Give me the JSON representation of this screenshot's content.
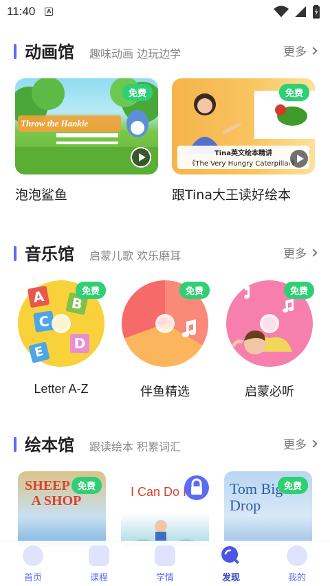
{
  "status": {
    "time": "11:40",
    "notif_letter": "A"
  },
  "sections": {
    "animation": {
      "title": "动画馆",
      "subtitle": "趣味动画 边玩边学",
      "more": "更多",
      "items": [
        {
          "title": "泡泡鲨鱼",
          "badge": "免费",
          "thumb_text": "Throw the Hankie"
        },
        {
          "title": "跟Tina大王读好绘本",
          "badge": "免费",
          "thumb_text": "Tina英文绘本精讲",
          "thumb_sub": "《The Very Hungry Caterpillar》"
        }
      ]
    },
    "music": {
      "title": "音乐馆",
      "subtitle": "启蒙儿歌 欢乐磨耳",
      "more": "更多",
      "items": [
        {
          "title": "Letter A-Z",
          "badge": "免费",
          "letters": [
            "A",
            "B",
            "C",
            "D",
            "E"
          ]
        },
        {
          "title": "伴鱼精选",
          "badge": "免费"
        },
        {
          "title": "启蒙必听",
          "badge": "免费"
        }
      ]
    },
    "books": {
      "title": "绘本馆",
      "subtitle": "跟读绘本 积累词汇",
      "more": "更多",
      "items": [
        {
          "cover_text": "SHEEP IN A SHOP",
          "badge": "免费",
          "locked": false
        },
        {
          "cover_text": "I Can Do It",
          "badge": "",
          "locked": true
        },
        {
          "cover_text": "Tom Big Drop",
          "badge": "免费",
          "locked": false
        }
      ]
    }
  },
  "bottom_nav": [
    {
      "label": "首页",
      "icon": "home-icon",
      "active": false
    },
    {
      "label": "课程",
      "icon": "course-icon",
      "active": false
    },
    {
      "label": "学情",
      "icon": "stats-icon",
      "active": false
    },
    {
      "label": "发现",
      "icon": "discover-icon",
      "active": true
    },
    {
      "label": "我的",
      "icon": "profile-icon",
      "active": false
    }
  ],
  "colors": {
    "accent": "#5a6cf5",
    "badge": "#2fcf73",
    "text": "#222222",
    "subtext": "#888888"
  }
}
